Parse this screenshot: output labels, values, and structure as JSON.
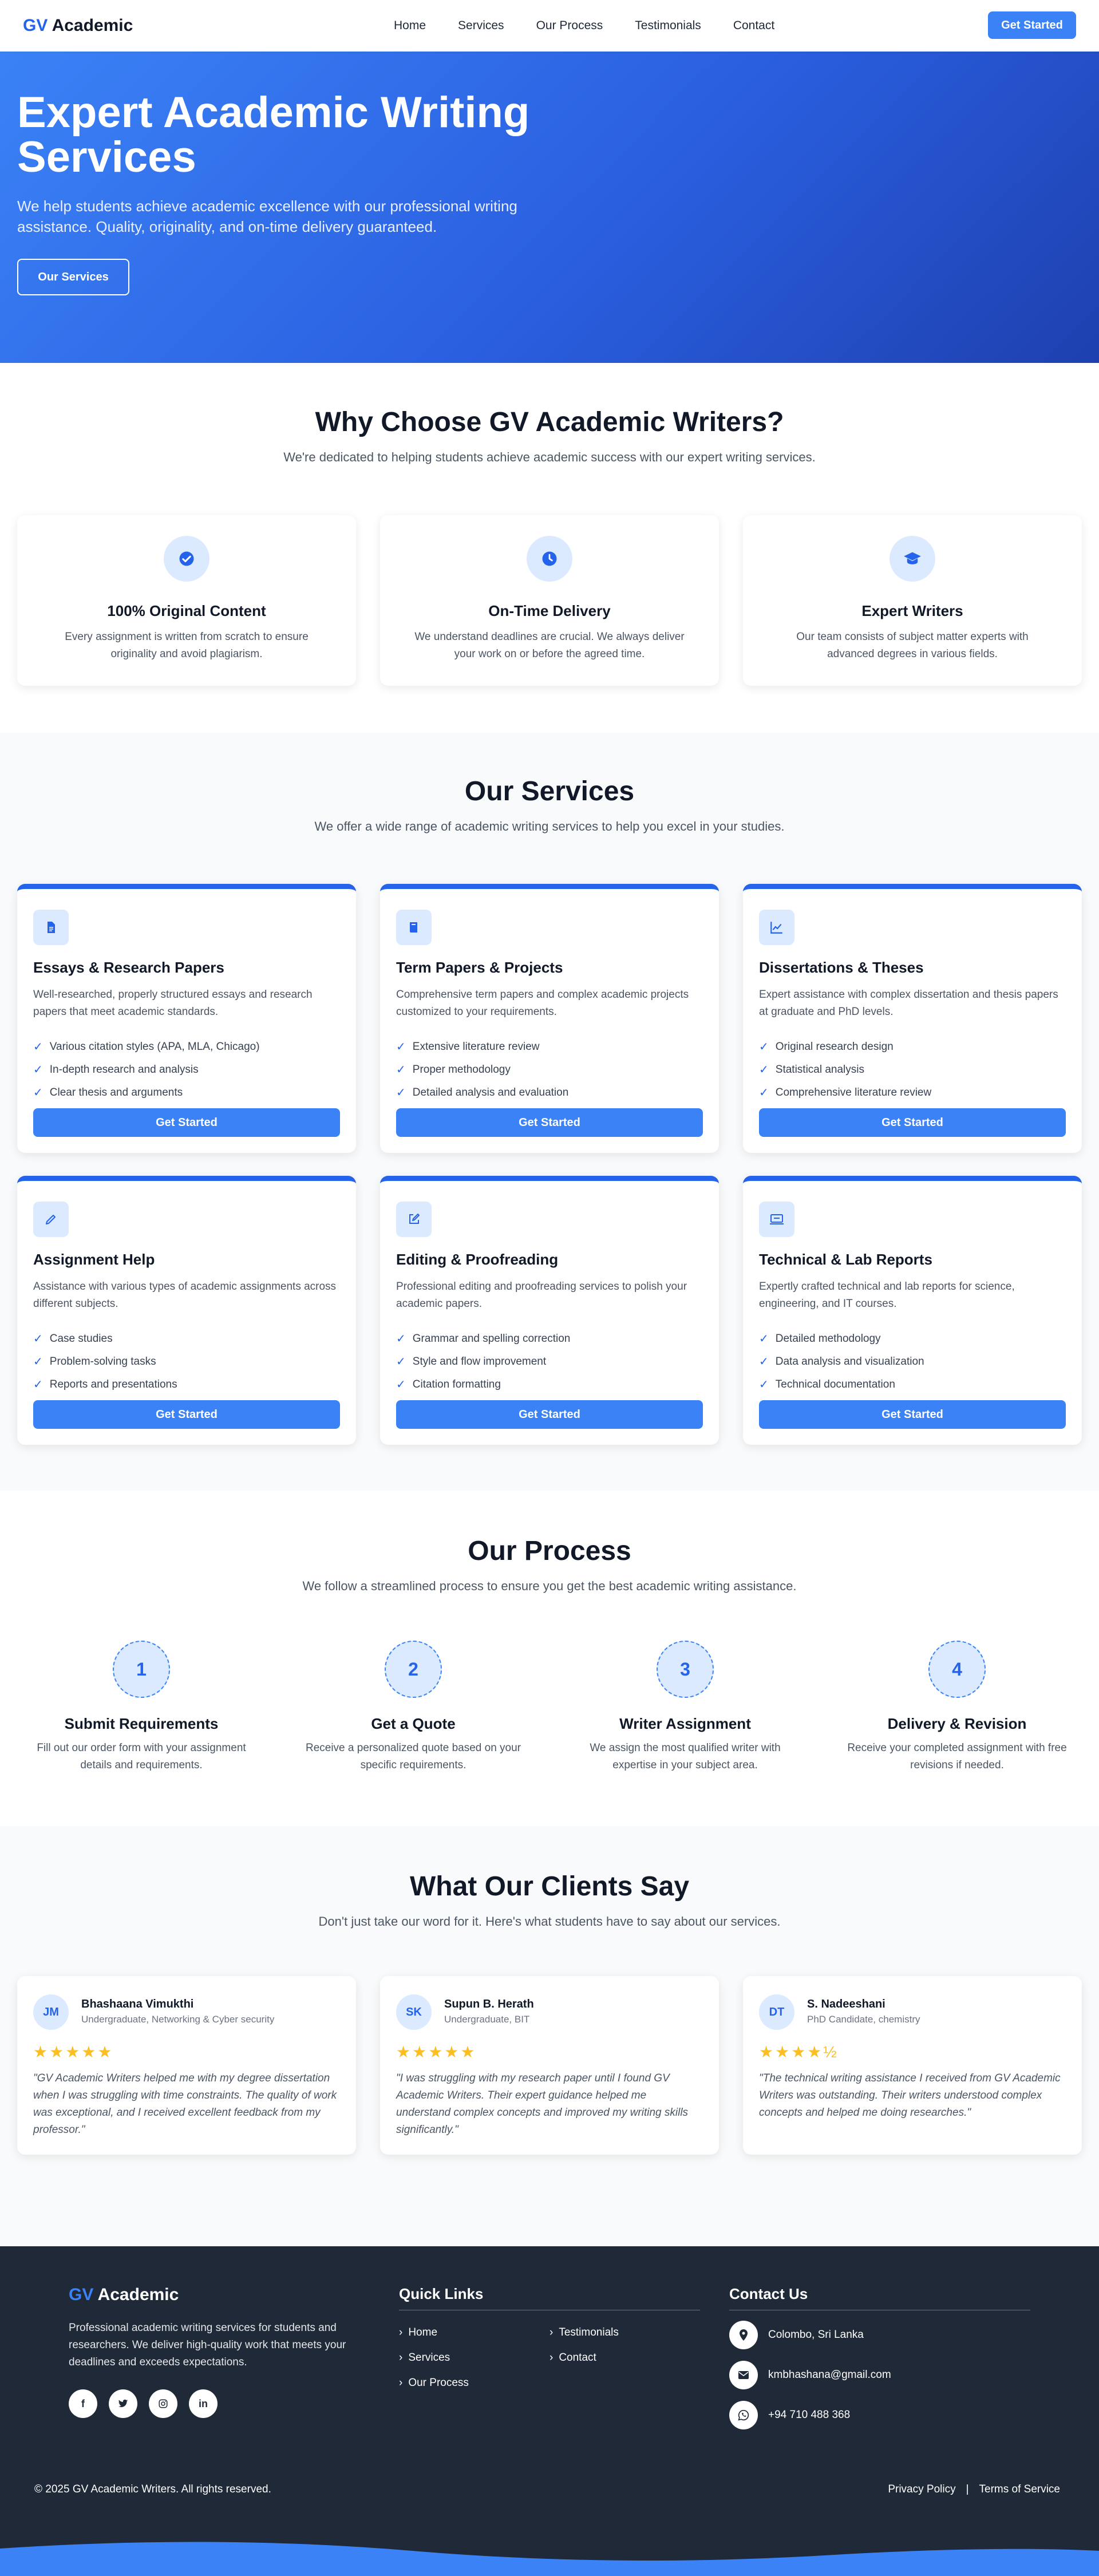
{
  "nav": {
    "logo_gv": "GV",
    "logo_rest": " Academic",
    "links": [
      "Home",
      "Services",
      "Our Process",
      "Testimonials",
      "Contact"
    ],
    "cta": "Get Started"
  },
  "hero": {
    "title": "Expert Academic Writing Services",
    "subtitle": "We help students achieve academic excellence with our professional writing assistance. Quality, originality, and on-time delivery guaranteed.",
    "button": "Our Services"
  },
  "why": {
    "title": "Why Choose GV Academic Writers?",
    "subtitle": "We're dedicated to helping students achieve academic success with our expert writing services.",
    "cards": [
      {
        "icon": "check-circle-icon",
        "title": "100% Original Content",
        "text": "Every assignment is written from scratch to ensure originality and avoid plagiarism."
      },
      {
        "icon": "clock-icon",
        "title": "On-Time Delivery",
        "text": "We understand deadlines are crucial. We always deliver your work on or before the agreed time."
      },
      {
        "icon": "graduation-cap-icon",
        "title": "Expert Writers",
        "text": "Our team consists of subject matter experts with advanced degrees in various fields."
      }
    ]
  },
  "services": {
    "title": "Our Services",
    "subtitle": "We offer a wide range of academic writing services to help you excel in your studies.",
    "button": "Get Started",
    "cards": [
      {
        "icon": "document-icon",
        "title": "Essays & Research Papers",
        "desc": "Well-researched, properly structured essays and research papers that meet academic standards.",
        "items": [
          "Various citation styles (APA, MLA, Chicago)",
          "In-depth research and analysis",
          "Clear thesis and arguments"
        ]
      },
      {
        "icon": "book-icon",
        "title": "Term Papers & Projects",
        "desc": "Comprehensive term papers and complex academic projects customized to your requirements.",
        "items": [
          "Extensive literature review",
          "Proper methodology",
          "Detailed analysis and evaluation"
        ]
      },
      {
        "icon": "chart-line-icon",
        "title": "Dissertations & Theses",
        "desc": "Expert assistance with complex dissertation and thesis papers at graduate and PhD levels.",
        "items": [
          "Original research design",
          "Statistical analysis",
          "Comprehensive literature review"
        ]
      },
      {
        "icon": "pencil-icon",
        "title": "Assignment Help",
        "desc": "Assistance with various types of academic assignments across different subjects.",
        "items": [
          "Case studies",
          "Problem-solving tasks",
          "Reports and presentations"
        ]
      },
      {
        "icon": "edit-icon",
        "title": "Editing & Proofreading",
        "desc": "Professional editing and proofreading services to polish your academic papers.",
        "items": [
          "Grammar and spelling correction",
          "Style and flow improvement",
          "Citation formatting"
        ]
      },
      {
        "icon": "lab-icon",
        "title": "Technical & Lab Reports",
        "desc": "Expertly crafted technical and lab reports for science, engineering, and IT courses.",
        "items": [
          "Detailed methodology",
          "Data analysis and visualization",
          "Technical documentation"
        ]
      }
    ]
  },
  "process": {
    "title": "Our Process",
    "subtitle": "We follow a streamlined process to ensure you get the best academic writing assistance.",
    "steps": [
      {
        "num": "1",
        "title": "Submit Requirements",
        "text": "Fill out our order form with your assignment details and requirements."
      },
      {
        "num": "2",
        "title": "Get a Quote",
        "text": "Receive a personalized quote based on your specific requirements."
      },
      {
        "num": "3",
        "title": "Writer Assignment",
        "text": "We assign the most qualified writer with expertise in your subject area."
      },
      {
        "num": "4",
        "title": "Delivery & Revision",
        "text": "Receive your completed assignment with free revisions if needed."
      }
    ]
  },
  "testimonials": {
    "title": "What Our Clients Say",
    "subtitle": "Don't just take our word for it. Here's what students have to say about our services.",
    "cards": [
      {
        "initials": "JM",
        "name": "Bhashaana Vimukthi",
        "role": "Undergraduate, Networking & Cyber security",
        "stars": "★★★★★",
        "rating": 5,
        "quote": "\"GV Academic Writers helped me with my degree dissertation when I was struggling with time constraints. The quality of work was exceptional, and I received excellent feedback from my professor.\""
      },
      {
        "initials": "SK",
        "name": "Supun B. Herath",
        "role": "Undergraduate, BIT",
        "stars": "★★★★★",
        "rating": 5,
        "quote": "\"I was struggling with my research paper until I found GV Academic Writers. Their expert guidance helped me understand complex concepts and improved my writing skills significantly.\""
      },
      {
        "initials": "DT",
        "name": "S. Nadeeshani",
        "role": "PhD Candidate, chemistry",
        "stars": "★★★★½",
        "rating": 4.5,
        "quote": "\"The technical writing assistance I received from GV Academic Writers was outstanding. Their writers understood complex concepts and helped me doing researches.\""
      }
    ]
  },
  "footer": {
    "logo_gv": "GV",
    "logo_rest": " Academic",
    "desc": "Professional academic writing services for students and researchers. We deliver high-quality work that meets your deadlines and exceeds expectations.",
    "socials": [
      "facebook-icon",
      "twitter-icon",
      "instagram-icon",
      "linkedin-icon"
    ],
    "quick_title": "Quick Links",
    "quick_links": [
      "Home",
      "Testimonials",
      "Services",
      "Contact",
      "Our Process"
    ],
    "contact_title": "Contact Us",
    "contact": [
      {
        "icon": "location-icon",
        "text": "Colombo, Sri Lanka"
      },
      {
        "icon": "email-icon",
        "text": "kmbhashana@gmail.com"
      },
      {
        "icon": "whatsapp-icon",
        "text": "+94 710 488 368"
      }
    ],
    "copyright": "© 2025 GV Academic Writers. All rights reserved.",
    "privacy": "Privacy Policy",
    "separator": "|",
    "terms": "Terms of Service"
  },
  "colors": {
    "primary": "#3b82f6",
    "primary_dark": "#1e40af",
    "footer_bg": "#1f2937",
    "star": "#fbbf24"
  }
}
